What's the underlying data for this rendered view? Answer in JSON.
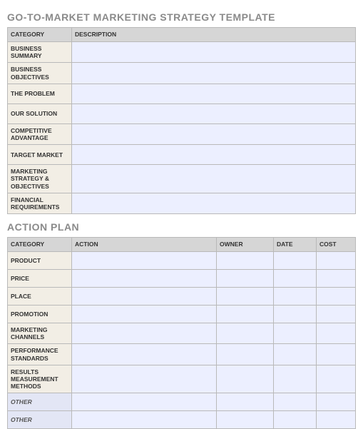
{
  "title": "GO-TO-MARKET MARKETING STRATEGY TEMPLATE",
  "table1": {
    "headers": {
      "category": "CATEGORY",
      "description": "DESCRIPTION"
    },
    "rows": [
      {
        "label": "BUSINESS SUMMARY",
        "value": ""
      },
      {
        "label": "BUSINESS OBJECTIVES",
        "value": ""
      },
      {
        "label": "THE PROBLEM",
        "value": ""
      },
      {
        "label": "OUR SOLUTION",
        "value": ""
      },
      {
        "label": "COMPETITIVE ADVANTAGE",
        "value": ""
      },
      {
        "label": "TARGET MARKET",
        "value": ""
      },
      {
        "label": "MARKETING STRATEGY & OBJECTIVES",
        "value": ""
      },
      {
        "label": "FINANCIAL REQUIREMENTS",
        "value": ""
      }
    ]
  },
  "section2_title": "ACTION PLAN",
  "table2": {
    "headers": {
      "category": "CATEGORY",
      "action": "ACTION",
      "owner": "OWNER",
      "date": "DATE",
      "cost": "COST"
    },
    "rows": [
      {
        "label": "PRODUCT",
        "action": "",
        "owner": "",
        "date": "",
        "cost": "",
        "other": false
      },
      {
        "label": "PRICE",
        "action": "",
        "owner": "",
        "date": "",
        "cost": "",
        "other": false
      },
      {
        "label": "PLACE",
        "action": "",
        "owner": "",
        "date": "",
        "cost": "",
        "other": false
      },
      {
        "label": "PROMOTION",
        "action": "",
        "owner": "",
        "date": "",
        "cost": "",
        "other": false
      },
      {
        "label": "MARKETING CHANNELS",
        "action": "",
        "owner": "",
        "date": "",
        "cost": "",
        "other": false
      },
      {
        "label": "PERFORMANCE STANDARDS",
        "action": "",
        "owner": "",
        "date": "",
        "cost": "",
        "other": false
      },
      {
        "label": "RESULTS MEASUREMENT METHODS",
        "action": "",
        "owner": "",
        "date": "",
        "cost": "",
        "other": false
      },
      {
        "label": "OTHER",
        "action": "",
        "owner": "",
        "date": "",
        "cost": "",
        "other": true
      },
      {
        "label": "OTHER",
        "action": "",
        "owner": "",
        "date": "",
        "cost": "",
        "other": true
      }
    ]
  }
}
